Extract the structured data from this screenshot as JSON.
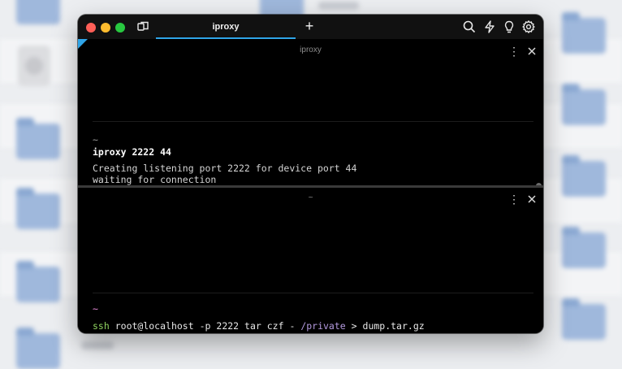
{
  "window": {
    "tab_title": "iproxy",
    "new_tab_symbol": "+",
    "colors": {
      "accent": "#2fa4e7",
      "close": "#ff5f57",
      "minimize": "#febc2e",
      "zoom": "#28c840"
    },
    "toolbar_icons": [
      "search-icon",
      "lightning-icon",
      "lightbulb-icon",
      "settings-gear-icon"
    ]
  },
  "pane_top": {
    "title": "iproxy",
    "menu_symbol": "⋮",
    "prompt_dir": "~",
    "command": "iproxy 2222 44",
    "output": [
      "Creating listening port 2222 for device port 44",
      "waiting for connection"
    ]
  },
  "pane_bottom": {
    "title": "~",
    "menu_symbol": "⋮",
    "prompt_dir": "~",
    "command_parts": {
      "program": "ssh",
      "host": "root@localhost",
      "flag": "-p",
      "port": "2222",
      "cmd": "tar",
      "args": "czf -",
      "path": "/private",
      "redirect": ">",
      "file": "dump.tar.gz"
    }
  }
}
